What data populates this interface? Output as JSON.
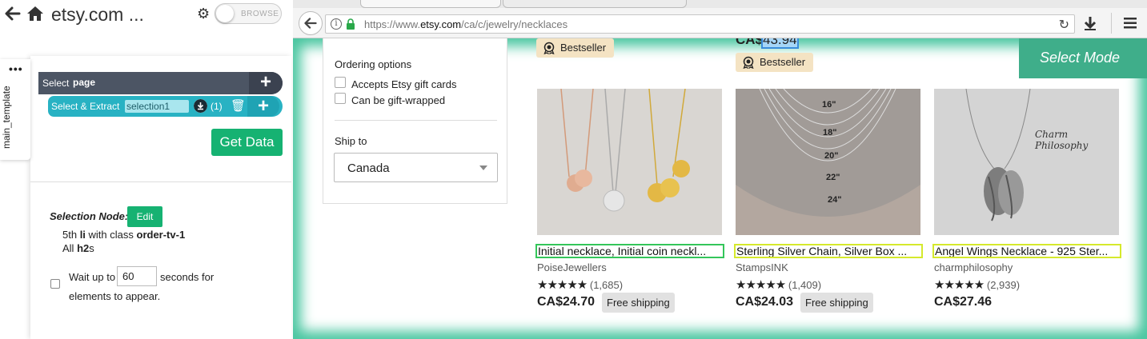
{
  "left_panel": {
    "title": "etsy.com ...",
    "toggle_label": "BROWSE",
    "template_tab": "main_template",
    "template_menu": "•••",
    "select_page": {
      "prefix": "Select",
      "target": "page",
      "plus": "+"
    },
    "select_extract": {
      "prefix": "Select & Extract",
      "name": "selection1",
      "count": "(1)",
      "plus": "+"
    },
    "get_data_label": "Get Data",
    "selection_node_label": "Selection Node:",
    "edit_label": "Edit",
    "node_line1_pre": "5th ",
    "node_line1_tag": "li",
    "node_line1_mid": " with class ",
    "node_line1_class": "order-tv-1",
    "node_line2_pre": "All ",
    "node_line2_tag": "h2",
    "node_line2_post": "s",
    "wait_prefix": "Wait up to",
    "wait_value": "60",
    "wait_suffix": "seconds for",
    "wait_line2": "elements to appear."
  },
  "browser": {
    "url_prefix": "https://www.",
    "url_domain": "etsy.com",
    "url_path": "/ca/c/jewelry/necklaces",
    "select_mode_label": "Select Mode",
    "filters": {
      "ordering_heading": "Ordering options",
      "options": [
        "Accepts Etsy gift cards",
        "Can be gift-wrapped"
      ],
      "ship_heading": "Ship to",
      "ship_value": "Canada"
    },
    "top_row": {
      "badge1": "Bestseller",
      "badge2": "Bestseller",
      "partial_price_prefix": "CA$",
      "partial_price_highlight": "43.94"
    },
    "products": [
      {
        "title": "Initial necklace, Initial coin neckl...",
        "shop": "PoiseJewellers",
        "stars": "★★★★★",
        "reviews": "(1,685)",
        "price": "CA$24.70",
        "shipping": "Free shipping"
      },
      {
        "title": "Sterling Silver Chain, Silver Box ...",
        "shop": "StampsINK",
        "stars": "★★★★★",
        "reviews": "(1,409)",
        "price": "CA$24.03",
        "shipping": "Free shipping"
      },
      {
        "title": "Angel Wings Necklace - 925 Ster...",
        "shop": "charmphilosophy",
        "stars": "★★★★★",
        "reviews": "(2,939)",
        "price": "CA$27.46",
        "shipping": ""
      }
    ],
    "product2_image_labels": [
      "16\"",
      "18\"",
      "20\"",
      "22\"",
      "24\""
    ],
    "product3_image_text": "Charm Philosophy"
  },
  "colors": {
    "select_page_bg": "#4c5564",
    "extract_bg": "#28b2c3",
    "green": "#16b272",
    "select_mode_bg": "#3fae8a",
    "highlight_yellow": "#d5e92c",
    "highlight_green": "#34c65a"
  }
}
